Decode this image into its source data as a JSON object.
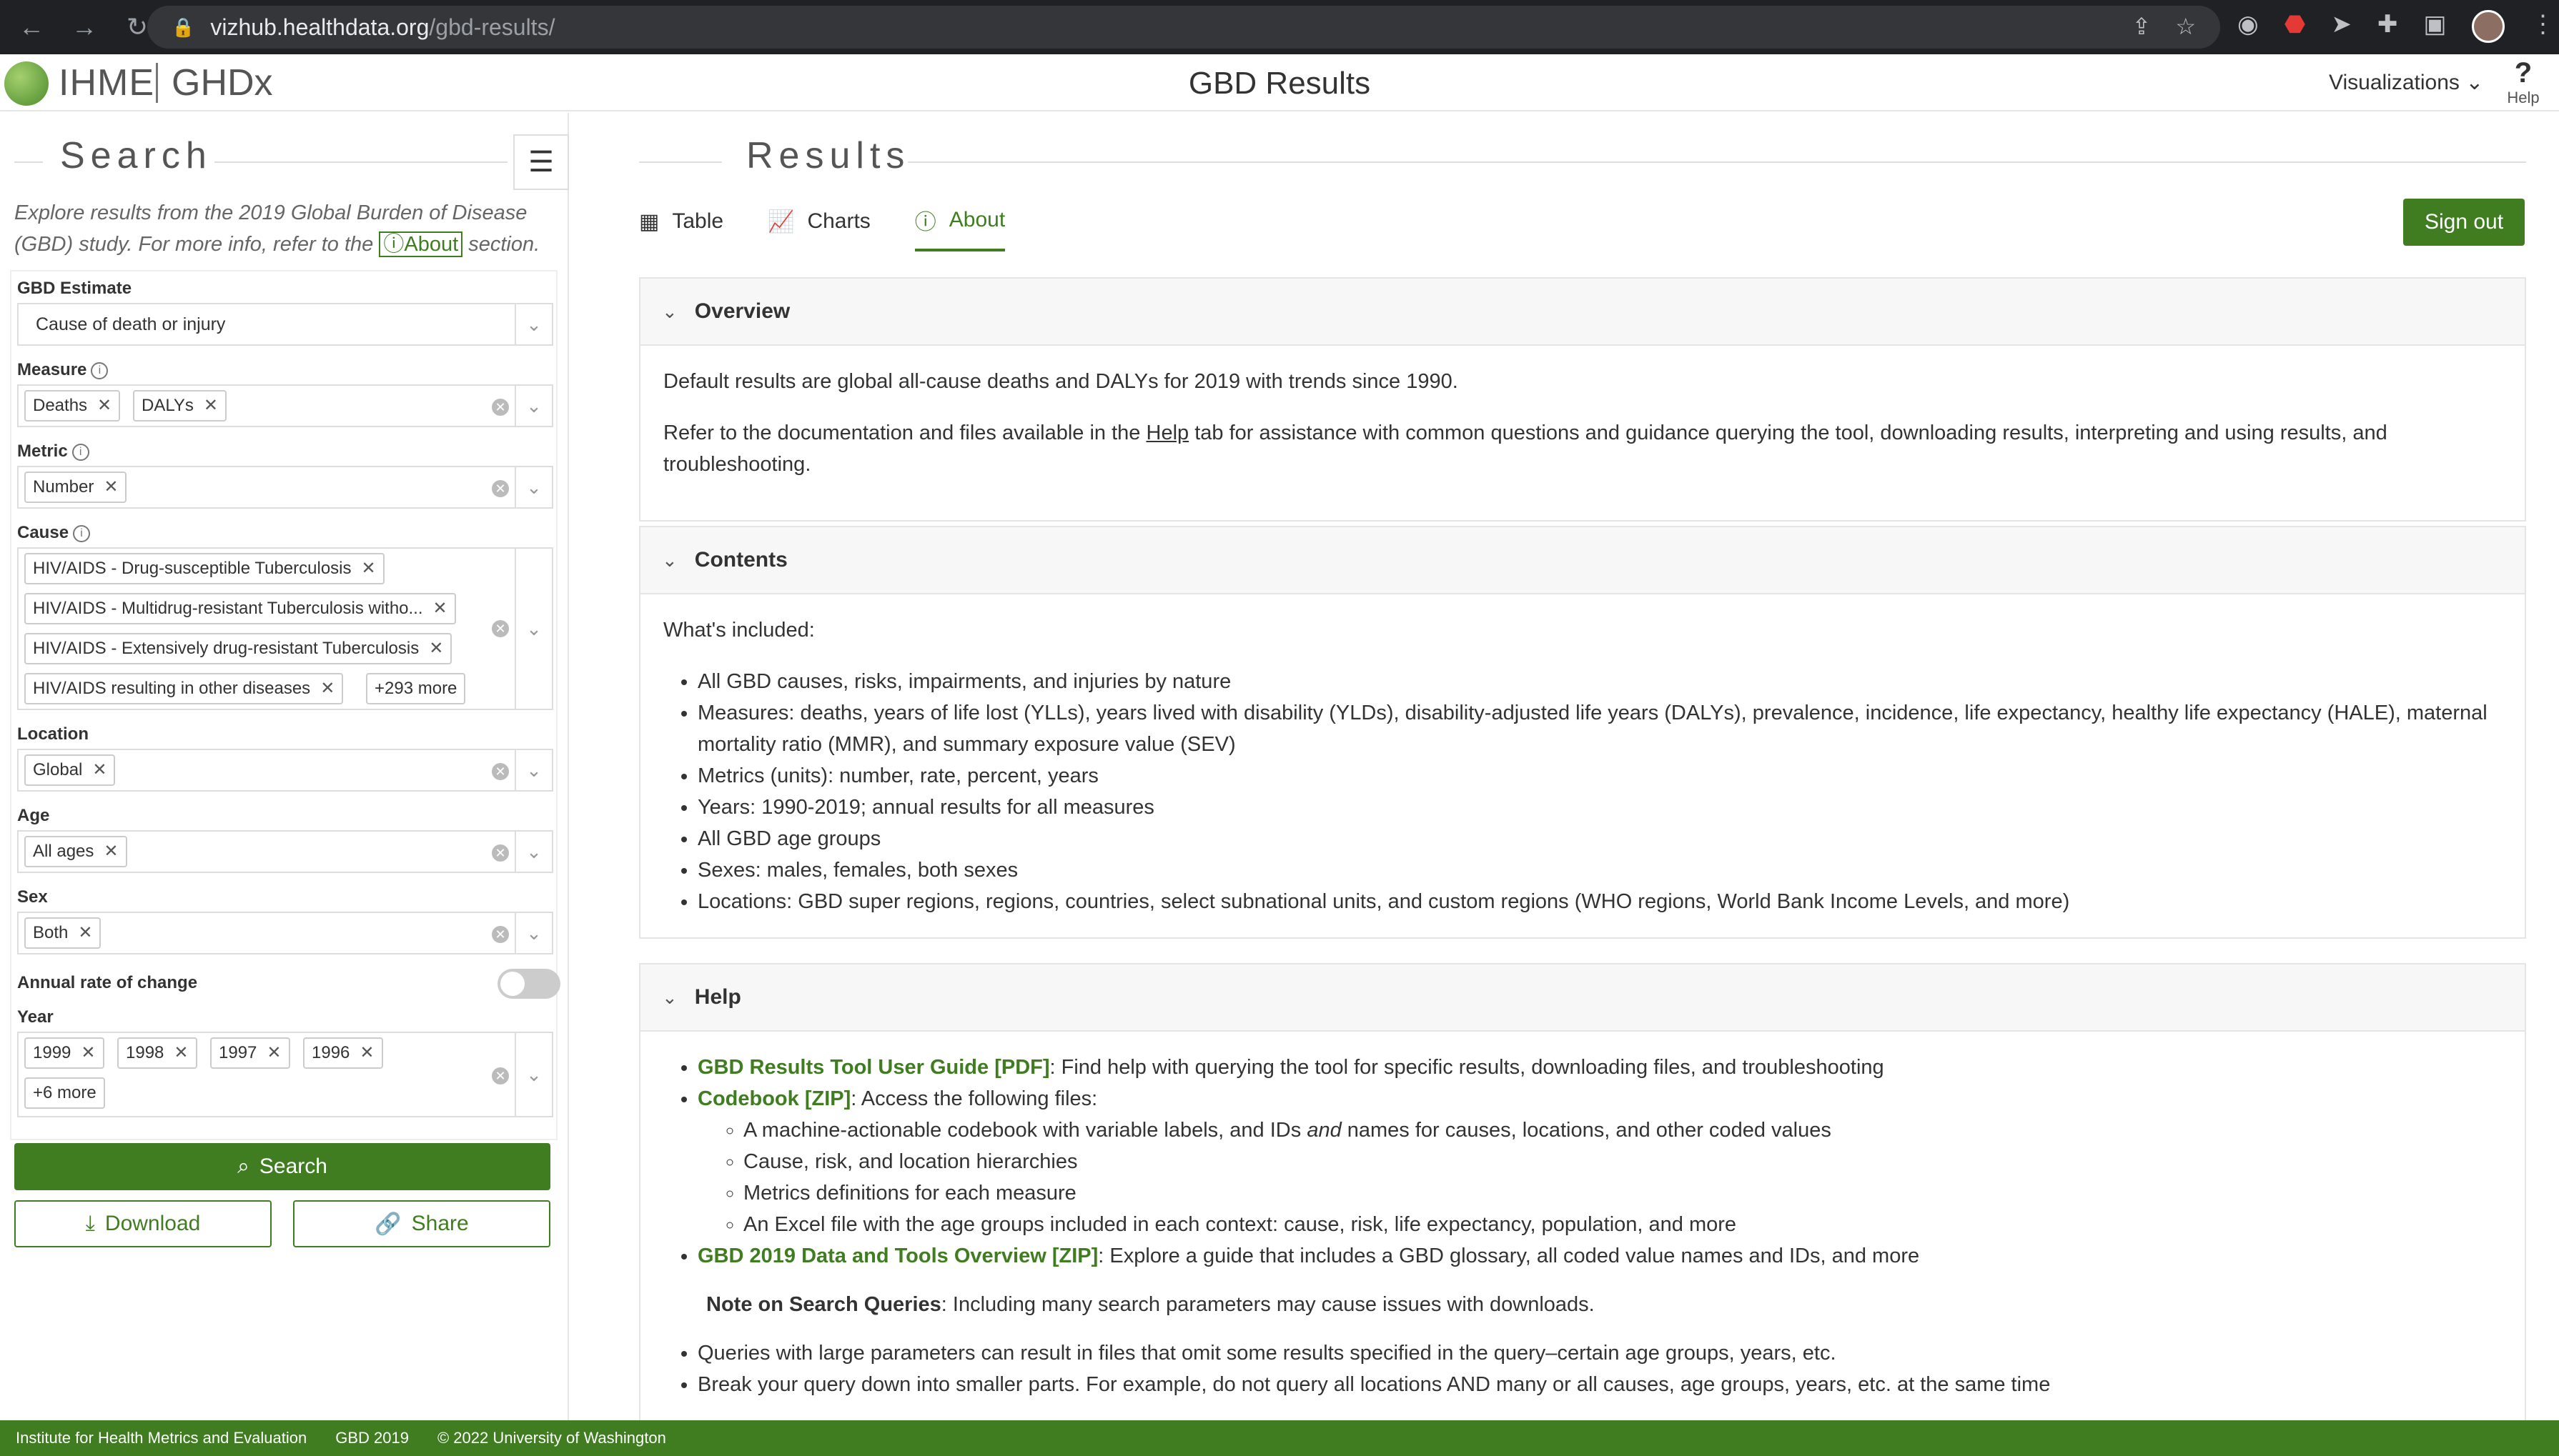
{
  "browser": {
    "url_host": "vizhub.healthdata.org",
    "url_path": "/gbd-results/"
  },
  "header": {
    "logo_ihme": "IHME",
    "logo_ghdx": "GHDx",
    "title": "GBD Results",
    "visualizations": "Visualizations",
    "help": "Help"
  },
  "sidebar": {
    "title": "Search",
    "intro_before": "Explore results from the 2019 Global Burden of Disease (GBD) study. For more info, refer to the",
    "about_link": "About",
    "intro_after": "section.",
    "gbd_estimate": {
      "label": "GBD Estimate",
      "value": "Cause of death or injury"
    },
    "measure": {
      "label": "Measure",
      "chips": [
        "Deaths",
        "DALYs"
      ]
    },
    "metric": {
      "label": "Metric",
      "chips": [
        "Number"
      ]
    },
    "cause": {
      "label": "Cause",
      "chips": [
        "HIV/AIDS - Drug-susceptible Tuberculosis",
        "HIV/AIDS - Multidrug-resistant Tuberculosis witho...",
        "HIV/AIDS - Extensively drug-resistant Tuberculosis",
        "HIV/AIDS resulting in other diseases"
      ],
      "more": "+293 more"
    },
    "location": {
      "label": "Location",
      "chips": [
        "Global"
      ]
    },
    "age": {
      "label": "Age",
      "chips": [
        "All ages"
      ]
    },
    "sex": {
      "label": "Sex",
      "chips": [
        "Both"
      ]
    },
    "annual_rate": {
      "label": "Annual rate of change",
      "enabled": false
    },
    "year": {
      "label": "Year",
      "chips": [
        "1999",
        "1998",
        "1997",
        "1996"
      ],
      "more": "+6 more"
    },
    "search_button": "Search",
    "download_button": "Download",
    "share_button": "Share"
  },
  "main": {
    "title": "Results",
    "tabs": [
      "Table",
      "Charts",
      "About"
    ],
    "active_tab": "About",
    "sign_out": "Sign out",
    "overview": {
      "heading": "Overview",
      "p1": "Default results are global all-cause deaths and DALYs for 2019 with trends since 1990.",
      "p2_before": "Refer to the documentation and files available in the",
      "p2_link": "Help",
      "p2_after": "tab for assistance with common questions and guidance querying the tool, downloading results, interpreting and using results, and troubleshooting."
    },
    "contents": {
      "heading": "Contents",
      "intro": "What's included:",
      "items": [
        "All GBD causes, risks, impairments, and injuries by nature",
        "Measures: deaths, years of life lost (YLLs), years lived with disability (YLDs), disability-adjusted life years (DALYs), prevalence, incidence, life expectancy, healthy life expectancy (HALE), maternal mortality ratio (MMR), and summary exposure value (SEV)",
        "Metrics (units): number, rate, percent, years",
        "Years: 1990-2019; annual results for all measures",
        "All GBD age groups",
        "Sexes: males, females, both sexes",
        "Locations: GBD super regions, regions, countries, select subnational units, and custom regions (WHO regions, World Bank Income Levels, and more)"
      ]
    },
    "help": {
      "heading": "Help",
      "guide_link": "GBD Results Tool User Guide [PDF]",
      "guide_text": ": Find help with querying the tool for specific results, downloading files, and troubleshooting",
      "codebook_link": "Codebook [ZIP]",
      "codebook_text": ": Access the following files:",
      "codebook_item1_a": "A machine-actionable codebook with variable labels, and IDs",
      "codebook_item1_em": "and",
      "codebook_item1_b": "names for causes, locations, and other coded values",
      "codebook_items": [
        "Cause, risk, and location hierarchies",
        "Metrics definitions for each measure",
        "An Excel file with the age groups included in each context: cause, risk, life expectancy, population, and more"
      ],
      "overview_link": "GBD 2019 Data and Tools Overview [ZIP]",
      "overview_text": ": Explore a guide that includes a GBD glossary, all coded value names and IDs, and more",
      "note_label": "Note on Search Queries",
      "note_text": ": Including many search parameters may cause issues with downloads.",
      "note_items": [
        "Queries with large parameters can result in files that omit some results specified in the query–certain age groups, years, etc.",
        "Break your query down into smaller parts. For example, do not query all locations AND many or all causes, age groups, years, etc. at the same time"
      ]
    }
  },
  "footer": {
    "org": "Institute for Health Metrics and Evaluation",
    "gbd": "GBD 2019",
    "copyright": "© 2022 University of Washington"
  },
  "colors": {
    "accent": "#3f7d20",
    "browser_bg": "#202124"
  }
}
